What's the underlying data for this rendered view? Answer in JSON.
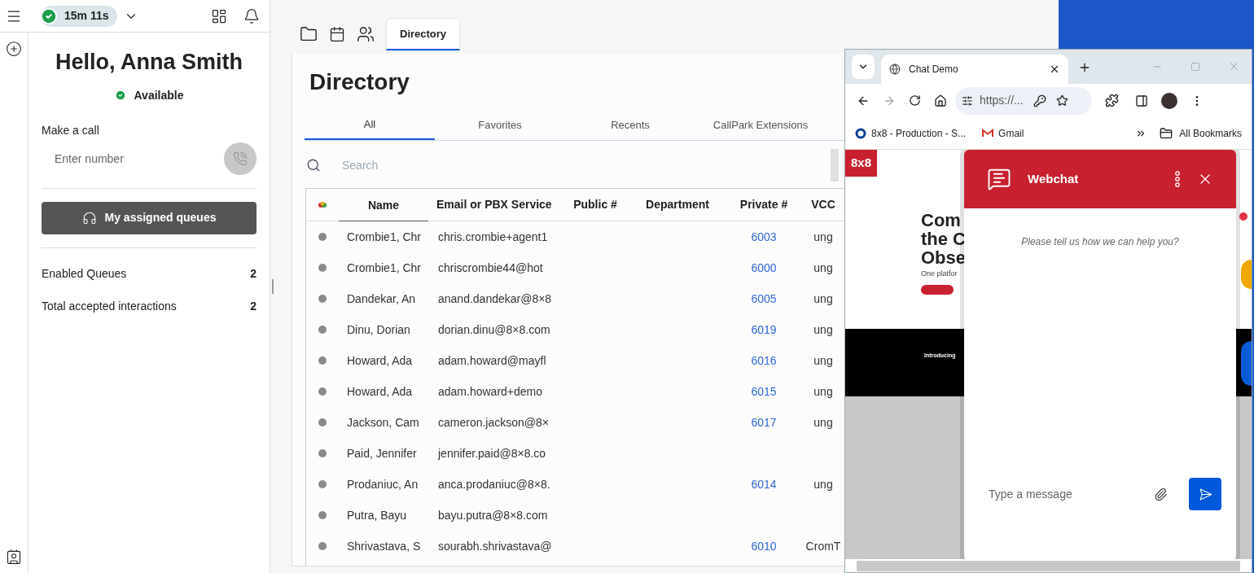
{
  "top_bar": {
    "timer": "15m 11s"
  },
  "greeting": "Hello, Anna Smith",
  "presence": "Available",
  "make_call": {
    "label": "Make a call",
    "placeholder": "Enter number"
  },
  "queues_button": "My assigned queues",
  "stats": [
    {
      "label": "Enabled Queues",
      "value": "2"
    },
    {
      "label": "Total accepted interactions",
      "value": "2"
    }
  ],
  "app_tabs": [
    {
      "kind": "folder",
      "selected": false
    },
    {
      "kind": "calendar",
      "selected": false
    },
    {
      "kind": "contacts",
      "selected": false
    },
    {
      "kind": "text",
      "label": "Directory",
      "selected": true
    }
  ],
  "directory": {
    "title": "Directory",
    "tabs": [
      {
        "label": "All",
        "selected": true
      },
      {
        "label": "Favorites",
        "selected": false
      },
      {
        "label": "Recents",
        "selected": false
      },
      {
        "label": "CallPark Extensions",
        "selected": false
      }
    ],
    "search": {
      "placeholder": "Search"
    },
    "columns": [
      "Name",
      "Email or PBX Service",
      "Public #",
      "Department",
      "Private #",
      "VCC"
    ],
    "rows": [
      {
        "cells": [
          "Crombie1, Chr",
          "chris.crombie+agent1",
          "",
          "",
          "6003",
          "ung"
        ]
      },
      {
        "cells": [
          "Crombie1, Chr",
          "chriscrombie44@hot",
          "",
          "",
          "6000",
          "ung"
        ]
      },
      {
        "cells": [
          "Dandekar, An",
          "anand.dandekar@8×8",
          "",
          "",
          "6005",
          "ung"
        ]
      },
      {
        "cells": [
          "Dinu, Dorian",
          "dorian.dinu@8×8.com",
          "",
          "",
          "6019",
          "ung"
        ]
      },
      {
        "cells": [
          "Howard, Ada",
          "adam.howard@mayfl",
          "",
          "",
          "6016",
          "ung"
        ]
      },
      {
        "cells": [
          "Howard, Ada",
          "adam.howard+demo",
          "",
          "",
          "6015",
          "ung"
        ]
      },
      {
        "cells": [
          "Jackson, Cam",
          "cameron.jackson@8×",
          "",
          "",
          "6017",
          "ung"
        ]
      },
      {
        "cells": [
          "Paid, Jennifer",
          "jennifer.paid@8×8.co",
          "",
          "",
          "",
          ""
        ]
      },
      {
        "cells": [
          "Prodaniuc, An",
          "anca.prodaniuc@8×8.",
          "",
          "",
          "6014",
          "ung"
        ]
      },
      {
        "cells": [
          "Putra, Bayu",
          "bayu.putra@8×8.com",
          "",
          "",
          "",
          ""
        ]
      },
      {
        "cells": [
          "Shrivastava, S",
          "sourabh.shrivastava@",
          "",
          "",
          "6010",
          "CromT"
        ]
      }
    ]
  },
  "browser": {
    "tab_title": "Chat Demo",
    "url": "https://...",
    "bookmarks": [
      {
        "kind": "site",
        "label": "8x8 - Production - S..."
      },
      {
        "kind": "gmail",
        "label": "Gmail"
      }
    ],
    "all_bookmarks": "All Bookmarks"
  },
  "site": {
    "logo": "8x8",
    "headline": [
      "Com",
      "the C",
      "Obse"
    ],
    "subtitle": "One platfor",
    "banner": "Introducing"
  },
  "webchat": {
    "title": "Webchat",
    "prompt": "Please tell us how we can help you?",
    "placeholder": "Type a message"
  }
}
